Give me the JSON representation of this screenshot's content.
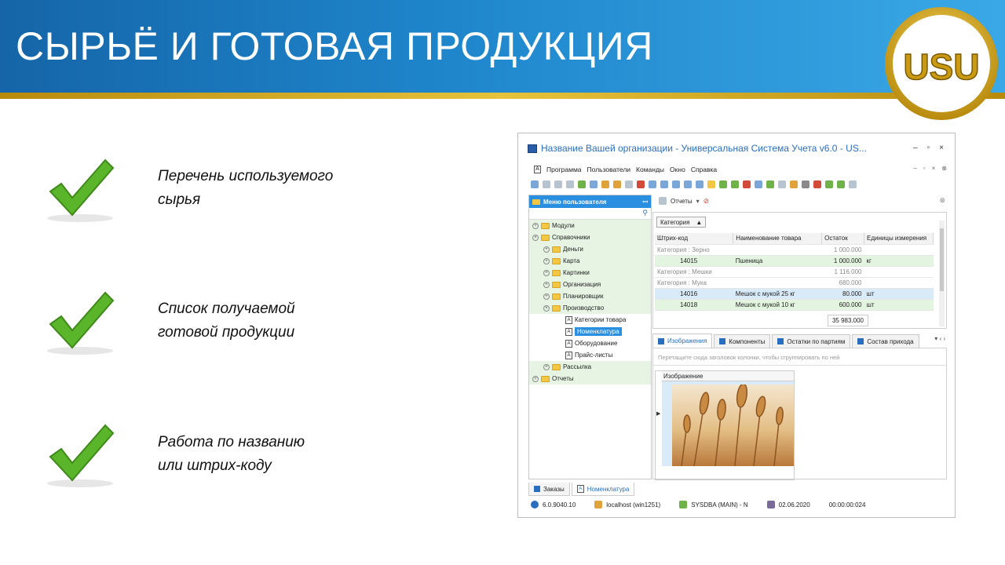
{
  "slide": {
    "title": "СЫРЬЁ И ГОТОВАЯ ПРОДУКЦИЯ",
    "logo_text": "USU",
    "bullets": [
      {
        "line1": "Перечень используемого",
        "line2": "сырья"
      },
      {
        "line1": "Список получаемой",
        "line2": "готовой продукции"
      },
      {
        "line1": "Работа по названию",
        "line2": "или штрих-коду"
      }
    ]
  },
  "window": {
    "title": "Название Вашей организации - Универсальная Система Учета v6.0 - US...",
    "controls": [
      "–",
      "▫",
      "×"
    ],
    "menu": [
      "Программа",
      "Пользователи",
      "Команды",
      "Окно",
      "Справка"
    ],
    "menu_icon": "A"
  },
  "left_pane": {
    "header": "Меню пользователя",
    "pin": "ꟷ",
    "tree": [
      {
        "label": "Модули",
        "level": 0,
        "kind": "folder",
        "glyph": "+"
      },
      {
        "label": "Справочники",
        "level": 0,
        "kind": "folder-open",
        "glyph": "×"
      },
      {
        "label": "Деньги",
        "level": 1,
        "kind": "folder",
        "glyph": "+"
      },
      {
        "label": "Карта",
        "level": 1,
        "kind": "folder",
        "glyph": "+"
      },
      {
        "label": "Картинки",
        "level": 1,
        "kind": "folder",
        "glyph": "+"
      },
      {
        "label": "Организация",
        "level": 1,
        "kind": "folder",
        "glyph": "+"
      },
      {
        "label": "Планировщик",
        "level": 1,
        "kind": "folder",
        "glyph": "+"
      },
      {
        "label": "Производство",
        "level": 1,
        "kind": "folder-open",
        "glyph": "×"
      },
      {
        "label": "Категории товара",
        "level": 2,
        "kind": "doc"
      },
      {
        "label": "Номенклатура",
        "level": 2,
        "kind": "doc",
        "selected": true
      },
      {
        "label": "Оборудование",
        "level": 2,
        "kind": "doc"
      },
      {
        "label": "Прайс-листы",
        "level": 2,
        "kind": "doc"
      },
      {
        "label": "Рассылка",
        "level": 1,
        "kind": "folder",
        "glyph": "+"
      },
      {
        "label": "Отчеты",
        "level": 0,
        "kind": "folder",
        "glyph": "+"
      }
    ]
  },
  "right_pane": {
    "reports_label": "Отчеты",
    "group_chip": "Категория",
    "columns": [
      "Штрих-код",
      "Наименование товара",
      "Остаток",
      "Единицы измерения"
    ],
    "rows": [
      {
        "type": "cat",
        "code": "Категория : Зерно",
        "name": "",
        "qty": "1 000.000",
        "unit": ""
      },
      {
        "type": "row",
        "code": "14015",
        "name": "Пшеница",
        "qty": "1 000.000",
        "unit": "кг"
      },
      {
        "type": "cat",
        "code": "Категория : Мешки",
        "name": "",
        "qty": "1 116.000",
        "unit": ""
      },
      {
        "type": "cat",
        "code": "Категория : Мука",
        "name": "",
        "qty": "680.000",
        "unit": ""
      },
      {
        "type": "row",
        "code": "14016",
        "name": "Мешок с мукой 25 кг",
        "qty": "80.000",
        "unit": "шт",
        "hl": true
      },
      {
        "type": "row",
        "code": "14018",
        "name": "Мешок с мукой 10 кг",
        "qty": "600.000",
        "unit": "шт"
      }
    ],
    "total": "35 983.000",
    "tabs": [
      {
        "label": "Изображения",
        "active": true
      },
      {
        "label": "Компоненты"
      },
      {
        "label": "Остатки по партиям"
      },
      {
        "label": "Состав прихода"
      }
    ],
    "drop_hint": "Перетащите сюда заголовок колонки, чтобы сгруппировать по ней",
    "image_column": "Изображение"
  },
  "bottom_tabs": [
    {
      "label": "Заказы"
    },
    {
      "label": "Номенклатура",
      "active": true
    }
  ],
  "status": {
    "version": "6.0.9040.10",
    "server": "localhost (win1251)",
    "user": "SYSDBA (MAIN) - N",
    "date": "02.06.2020",
    "timer": "00:00:00:024"
  },
  "colors": {
    "header_blue": "#1f86cc",
    "gold_stripe": "#e6c23a",
    "selection": "#2a8fe0",
    "group_green": "#e3f5e0",
    "check_green": "#5ab52a"
  }
}
